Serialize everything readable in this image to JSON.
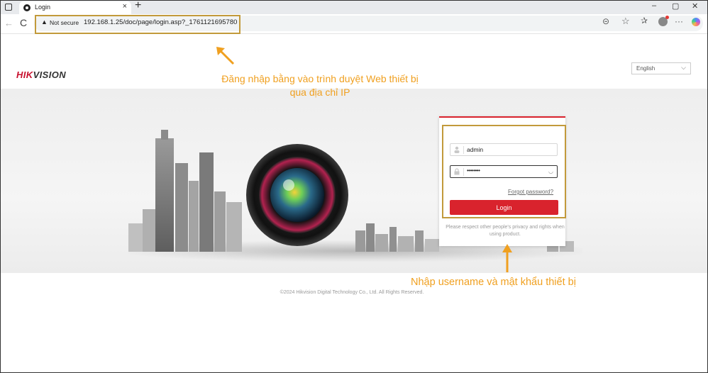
{
  "browser": {
    "tab_title": "Login",
    "tab_close": "×",
    "new_tab": "+",
    "window_controls": {
      "minimize": "–",
      "restore": "▢",
      "close": "✕"
    },
    "nav": {
      "back": "←",
      "reload": "C"
    },
    "security_label": "Not secure",
    "url": "192.168.1.25/doc/page/login.asp?_1761121695780",
    "toolbar_icons": [
      "zoom-icon",
      "favorite-star-icon",
      "favorites-icon",
      "profile-icon",
      "more-icon",
      "copilot-icon"
    ],
    "more": "···"
  },
  "page": {
    "logo": {
      "part1": "HIK",
      "part2": "VISION"
    },
    "language": "English",
    "login": {
      "username_value": "admin",
      "password_mask": "••••••••",
      "forgot_password": "Forgot password?",
      "login_button": "Login",
      "notice": "Please respect other people's privacy and rights when using product."
    },
    "footer": "©2024 Hikvision Digital Technology Co., Ltd. All Rights Reserved."
  },
  "annotations": {
    "top": "Đăng nhập bằng vào trình duyệt Web thiết bị qua địa chỉ IP",
    "bottom": "Nhập username và mật khẩu thiết bị"
  },
  "colors": {
    "accent_red": "#d9232d",
    "annotation": "#f0a020",
    "highlight_box": "#c29a3b"
  }
}
